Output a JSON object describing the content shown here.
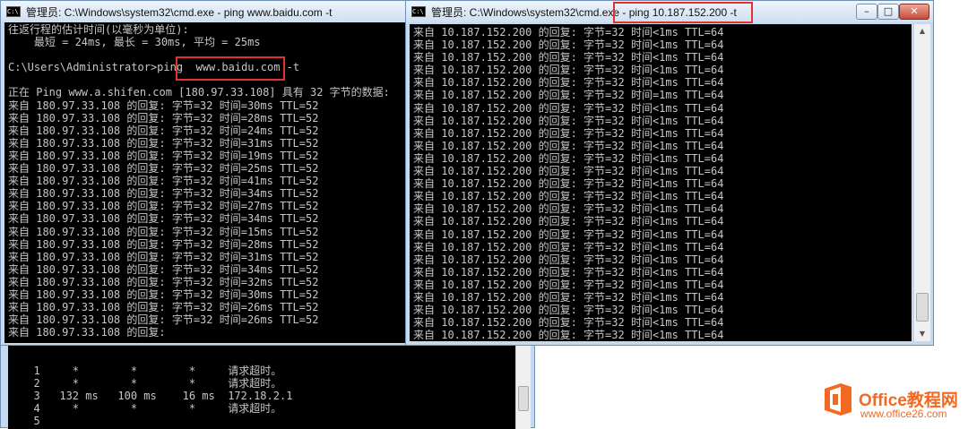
{
  "left_window": {
    "title": "管理员: C:\\Windows\\system32\\cmd.exe - ping  www.baidu.com -t",
    "lines": [
      "往返行程的估计时间(以毫秒为单位):",
      "    最短 = 24ms, 最长 = 30ms, 平均 = 25ms",
      "",
      "C:\\Users\\Administrator>ping  www.baidu.com -t",
      "",
      "正在 Ping www.a.shifen.com [180.97.33.108] 具有 32 字节的数据:",
      "来自 180.97.33.108 的回复: 字节=32 时间=30ms TTL=52",
      "来自 180.97.33.108 的回复: 字节=32 时间=28ms TTL=52",
      "来自 180.97.33.108 的回复: 字节=32 时间=24ms TTL=52",
      "来自 180.97.33.108 的回复: 字节=32 时间=31ms TTL=52",
      "来自 180.97.33.108 的回复: 字节=32 时间=19ms TTL=52",
      "来自 180.97.33.108 的回复: 字节=32 时间=25ms TTL=52",
      "来自 180.97.33.108 的回复: 字节=32 时间=41ms TTL=52",
      "来自 180.97.33.108 的回复: 字节=32 时间=34ms TTL=52",
      "来自 180.97.33.108 的回复: 字节=32 时间=27ms TTL=52",
      "来自 180.97.33.108 的回复: 字节=32 时间=34ms TTL=52",
      "来自 180.97.33.108 的回复: 字节=32 时间=15ms TTL=52",
      "来自 180.97.33.108 的回复: 字节=32 时间=28ms TTL=52",
      "来自 180.97.33.108 的回复: 字节=32 时间=31ms TTL=52",
      "来自 180.97.33.108 的回复: 字节=32 时间=34ms TTL=52",
      "来自 180.97.33.108 的回复: 字节=32 时间=32ms TTL=52",
      "来自 180.97.33.108 的回复: 字节=32 时间=30ms TTL=52",
      "来自 180.97.33.108 的回复: 字节=32 时间=26ms TTL=52",
      "来自 180.97.33.108 的回复: 字节=32 时间=26ms TTL=52",
      "来自 180.97.33.108 的回复:"
    ]
  },
  "right_window": {
    "title": "管理员: C:\\Windows\\system32\\cmd.exe - ping  10.187.152.200 -t",
    "lines": [
      "来自 10.187.152.200 的回复: 字节=32 时间<1ms TTL=64",
      "来自 10.187.152.200 的回复: 字节=32 时间<1ms TTL=64",
      "来自 10.187.152.200 的回复: 字节=32 时间<1ms TTL=64",
      "来自 10.187.152.200 的回复: 字节=32 时间<1ms TTL=64",
      "来自 10.187.152.200 的回复: 字节=32 时间<1ms TTL=64",
      "来自 10.187.152.200 的回复: 字节=32 时间=1ms TTL=64",
      "来自 10.187.152.200 的回复: 字节=32 时间<1ms TTL=64",
      "来自 10.187.152.200 的回复: 字节=32 时间<1ms TTL=64",
      "来自 10.187.152.200 的回复: 字节=32 时间<1ms TTL=64",
      "来自 10.187.152.200 的回复: 字节=32 时间<1ms TTL=64",
      "来自 10.187.152.200 的回复: 字节=32 时间<1ms TTL=64",
      "来自 10.187.152.200 的回复: 字节=32 时间<1ms TTL=64",
      "来自 10.187.152.200 的回复: 字节=32 时间<1ms TTL=64",
      "来自 10.187.152.200 的回复: 字节=32 时间<1ms TTL=64",
      "来自 10.187.152.200 的回复: 字节=32 时间<1ms TTL=64",
      "来自 10.187.152.200 的回复: 字节=32 时间<1ms TTL=64",
      "来自 10.187.152.200 的回复: 字节=32 时间<1ms TTL=64",
      "来自 10.187.152.200 的回复: 字节=32 时间<1ms TTL=64",
      "来自 10.187.152.200 的回复: 字节=32 时间<1ms TTL=64",
      "来自 10.187.152.200 的回复: 字节=32 时间<1ms TTL=64",
      "来自 10.187.152.200 的回复: 字节=32 时间<1ms TTL=64",
      "来自 10.187.152.200 的回复: 字节=32 时间<1ms TTL=64",
      "来自 10.187.152.200 的回复: 字节=32 时间<1ms TTL=64",
      "来自 10.187.152.200 的回复: 字节=32 时间<1ms TTL=64",
      "来自 10.187.152.200 的回复: 字节=32 时间<1ms TTL=64",
      "来自 10.187.152.200 的回复: 字节=32 时间<1ms TTL=64"
    ]
  },
  "tracert_window": {
    "lines": [
      "",
      "  1     *        *        *     请求超时。",
      "  2     *        *        *     请求超时。",
      "  3   132 ms   100 ms    16 ms  172.18.2.1",
      "  4     *        *        *     请求超时。",
      "  5"
    ]
  },
  "watermark": {
    "name": "Office教程网",
    "url": "www.office26.com"
  },
  "colors": {
    "console_bg": "#000000",
    "console_text": "#c6c6c6",
    "highlight_box": "#e0332b",
    "brand": "#f26a21"
  }
}
